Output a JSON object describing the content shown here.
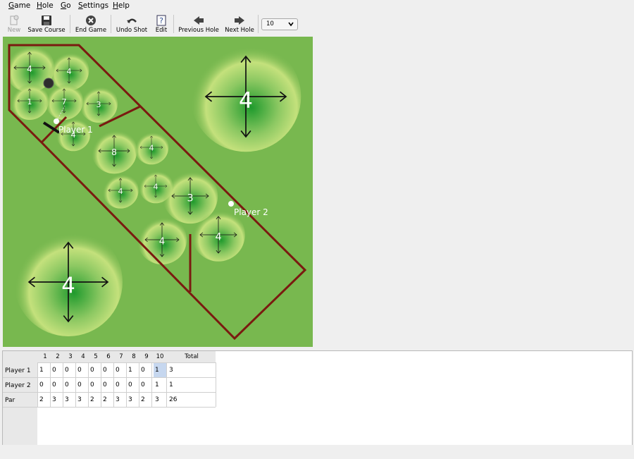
{
  "menubar": {
    "items": [
      {
        "label": "Game",
        "mnemonic": "G",
        "rest": "ame"
      },
      {
        "label": "Hole",
        "mnemonic": "H",
        "rest": "ole"
      },
      {
        "label": "Go",
        "mnemonic": "G",
        "rest": "o"
      },
      {
        "label": "Settings",
        "mnemonic": "S",
        "rest": "ettings"
      },
      {
        "label": "Help",
        "mnemonic": "H",
        "rest": "elp"
      }
    ]
  },
  "toolbar": {
    "new_label": "New",
    "save_course_label": "Save Course",
    "end_game_label": "End Game",
    "undo_shot_label": "Undo Shot",
    "edit_label": "Edit",
    "previous_hole_label": "Previous Hole",
    "next_hole_label": "Next Hole",
    "hole_select_value": "10"
  },
  "course": {
    "colors": {
      "grass": "#78b84f",
      "wall": "#7a1a10",
      "bush_light": "#d6ea86",
      "bush_dark": "#1f9a2d"
    },
    "player1_label": "Player 1",
    "player2_label": "Player 2",
    "slopes": [
      {
        "value": "4"
      },
      {
        "value": "4"
      },
      {
        "value": "1"
      },
      {
        "value": "7"
      },
      {
        "value": "3"
      },
      {
        "value": "4"
      },
      {
        "value": "8"
      },
      {
        "value": "4"
      },
      {
        "value": "4"
      },
      {
        "value": "4"
      },
      {
        "value": "3"
      },
      {
        "value": "4"
      },
      {
        "value": "4"
      },
      {
        "value": "4"
      },
      {
        "value": "4"
      }
    ]
  },
  "scores": {
    "columns": [
      "1",
      "2",
      "3",
      "4",
      "5",
      "6",
      "7",
      "8",
      "9",
      "10",
      "Total"
    ],
    "rows": [
      {
        "name": "Player 1",
        "cells": [
          "1",
          "0",
          "0",
          "0",
          "0",
          "0",
          "0",
          "1",
          "0",
          "1",
          "3"
        ]
      },
      {
        "name": "Player 2",
        "cells": [
          "0",
          "0",
          "0",
          "0",
          "0",
          "0",
          "0",
          "0",
          "0",
          "1",
          "1"
        ]
      },
      {
        "name": "Par",
        "cells": [
          "2",
          "3",
          "3",
          "3",
          "2",
          "2",
          "3",
          "3",
          "2",
          "3",
          "26"
        ]
      }
    ]
  }
}
